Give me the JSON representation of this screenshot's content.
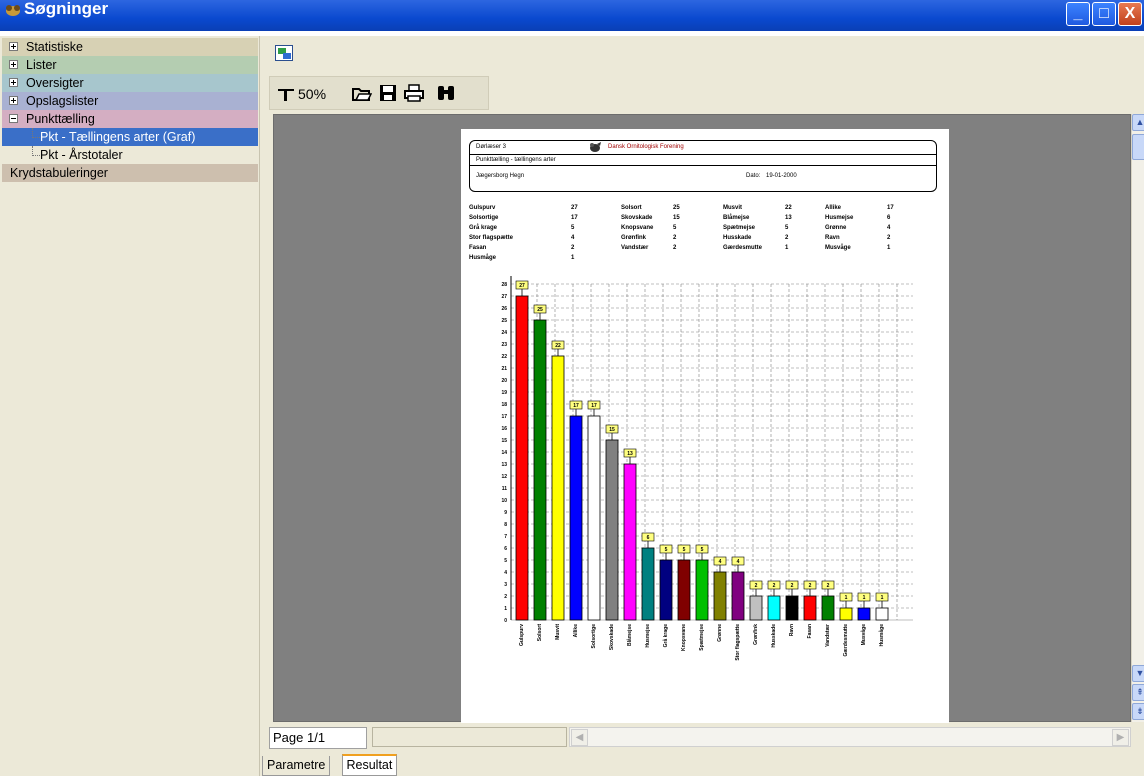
{
  "window": {
    "title": "Søgninger",
    "minimize_label": "_",
    "maximize_label": "□",
    "close_label": "X"
  },
  "tree": {
    "items": [
      {
        "label": "Statistiske",
        "expanded": false,
        "bg": "#d7d1b4"
      },
      {
        "label": "Lister",
        "expanded": false,
        "bg": "#b4cdb1"
      },
      {
        "label": "Oversigter",
        "expanded": false,
        "bg": "#a7c6cd"
      },
      {
        "label": "Opslagslister",
        "expanded": false,
        "bg": "#a9b1d2"
      },
      {
        "label": "Punkttælling",
        "expanded": true,
        "bg": "#d4aec2"
      },
      {
        "label": "Pkt - Tællingens arter (Graf)",
        "child": true,
        "selected": true,
        "bg": "#3a6fc8"
      },
      {
        "label": "Pkt - Årstotaler",
        "child": true,
        "bg": ""
      },
      {
        "label": "Krydstabuleringer",
        "leaf": true,
        "bg": "#cdbfae"
      }
    ]
  },
  "toolbar": {
    "zoom_label": "50%",
    "icons": [
      "export-icon",
      "zoom-icon",
      "open-folder-icon",
      "save-icon",
      "print-icon",
      "binoculars-icon"
    ]
  },
  "report": {
    "header_left": "Dørlæser 3",
    "org_name": "Dansk Ornitologisk Forening",
    "subtitle": "Punkttælling - tællingens arter",
    "location": "Jægersborg Hegn",
    "date_label": "Dato:",
    "date_value": "19-01-2000",
    "species_table": [
      [
        "Gulspurv",
        "27",
        "Solsort",
        "25",
        "Musvit",
        "22",
        "Allike",
        "17"
      ],
      [
        "Solsortige",
        "17",
        "Skovskade",
        "15",
        "Blåmejse",
        "13",
        "Husmejse",
        "6"
      ],
      [
        "Grå krage",
        "5",
        "Knopsvane",
        "5",
        "Spætmejse",
        "5",
        "Grønne",
        "4"
      ],
      [
        "Stor flagspætte",
        "4",
        "Grønfink",
        "2",
        "Husskade",
        "2",
        "Ravn",
        "2"
      ],
      [
        "Fasan",
        "2",
        "Vandstær",
        "2",
        "Gærdesmutte",
        "1",
        "Musvåge",
        "1"
      ],
      [
        "Husmåge",
        "1",
        "",
        "",
        "",
        "",
        "",
        ""
      ]
    ]
  },
  "chart_data": {
    "type": "bar",
    "categories": [
      "Gulspurv",
      "Solsort",
      "Musvit",
      "Allike",
      "Solsortige",
      "Skovskade",
      "Blåmejse",
      "Husmejse",
      "Grå krage",
      "Knopsvane",
      "Spætmejse",
      "Grønne",
      "Stor flagspætte",
      "Grønfink",
      "Husskade",
      "Ravn",
      "Fasan",
      "Vandstær",
      "Gærdesmutte",
      "Musvåge",
      "Husmåge"
    ],
    "values": [
      27,
      25,
      22,
      17,
      17,
      15,
      13,
      6,
      5,
      5,
      5,
      4,
      4,
      2,
      2,
      2,
      2,
      2,
      1,
      1,
      1
    ],
    "colors": [
      "#ff0000",
      "#008000",
      "#ffff00",
      "#0000ff",
      "#ffffff",
      "#808080",
      "#ff00ff",
      "#008080",
      "#000080",
      "#800000",
      "#00c000",
      "#808000",
      "#800080",
      "#c0c0c0",
      "#00ffff",
      "#000000",
      "#ff0000",
      "#008000",
      "#ffff00",
      "#0000ff",
      "#ffffff"
    ],
    "ylim": [
      0,
      28
    ],
    "yticks": [
      0,
      1,
      2,
      3,
      4,
      5,
      6,
      7,
      8,
      9,
      10,
      11,
      12,
      13,
      14,
      15,
      16,
      17,
      18,
      19,
      20,
      21,
      22,
      23,
      24,
      25,
      26,
      27,
      28
    ],
    "grid": true
  },
  "status": {
    "page_info": "Page 1/1"
  },
  "tabs": [
    {
      "label": "Parametre",
      "active": false
    },
    {
      "label": "Resultat",
      "active": true
    }
  ]
}
